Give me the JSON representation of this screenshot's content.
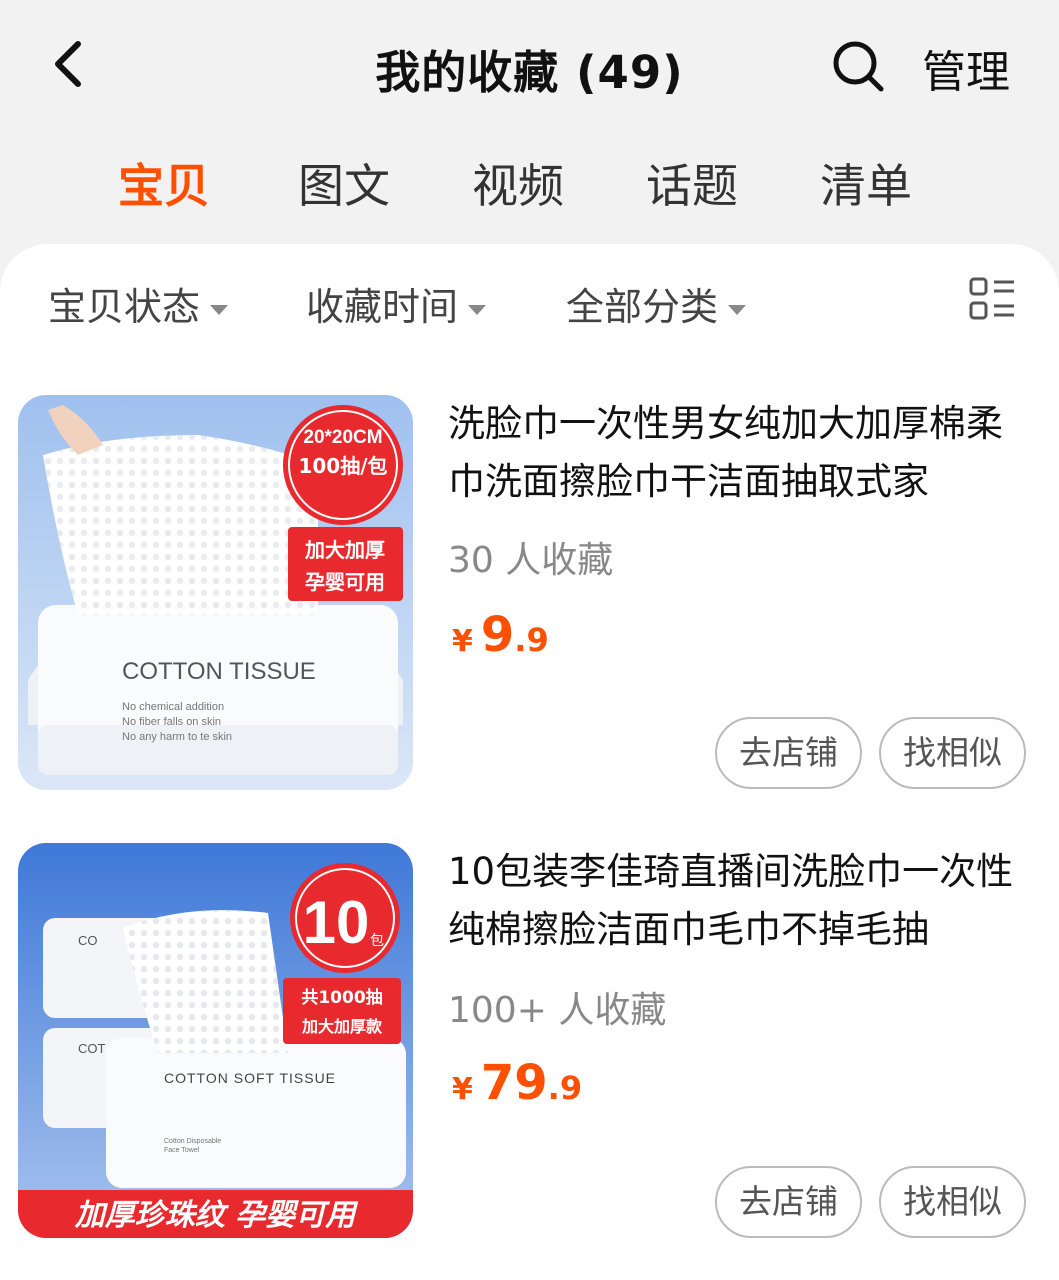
{
  "header": {
    "title": "我的收藏",
    "count": "(49)",
    "manage_label": "管理"
  },
  "tabs": [
    {
      "label": "宝贝",
      "active": true
    },
    {
      "label": "图文",
      "active": false
    },
    {
      "label": "视频",
      "active": false
    },
    {
      "label": "话题",
      "active": false
    },
    {
      "label": "清单",
      "active": false
    }
  ],
  "filters": [
    {
      "label": "宝贝状态"
    },
    {
      "label": "收藏时间"
    },
    {
      "label": "全部分类"
    }
  ],
  "products": [
    {
      "title": "洗脸巾一次性男女纯加大加厚棉柔巾洗面擦脸巾干洁面抽取式家",
      "favorites": "30 人收藏",
      "price_currency": "¥",
      "price_int": "9",
      "price_dec": ".9",
      "shop_button": "去店铺",
      "similar_button": "找相似",
      "image": {
        "badge_line1": "20*20CM",
        "badge_line2": "100抽/包",
        "tag_line1": "加大加厚",
        "tag_line2": "孕婴可用",
        "box_brand": "COTTON TISSUE",
        "box_line1": "No chemical addition",
        "box_line2": "No fiber falls on skin",
        "box_line3": "No any harm to te skin"
      }
    },
    {
      "title": "10包装李佳琦直播间洗脸巾一次性纯棉擦脸洁面巾毛巾不掉毛抽",
      "favorites": "100+ 人收藏",
      "price_currency": "¥",
      "price_int": "79",
      "price_dec": ".9",
      "shop_button": "去店铺",
      "similar_button": "找相似",
      "image": {
        "badge_num": "10",
        "badge_unit": "包",
        "tag_line1": "共1000抽",
        "tag_line2": "加大加厚款",
        "box_brand": "COTTON SOFT TISSUE",
        "box_small1": "Cotton Disposable",
        "box_small2": "Face Towel",
        "side_label1": "CO",
        "side_label2": "COT",
        "banner": "加厚珍珠纹 孕婴可用"
      }
    }
  ],
  "colors": {
    "accent": "#ff5000",
    "badge_red": "#e8292e",
    "background": "#f2f2f2"
  },
  "icons": [
    "chevron-left-icon",
    "search-icon",
    "list-layout-icon",
    "caret-down-icon"
  ]
}
